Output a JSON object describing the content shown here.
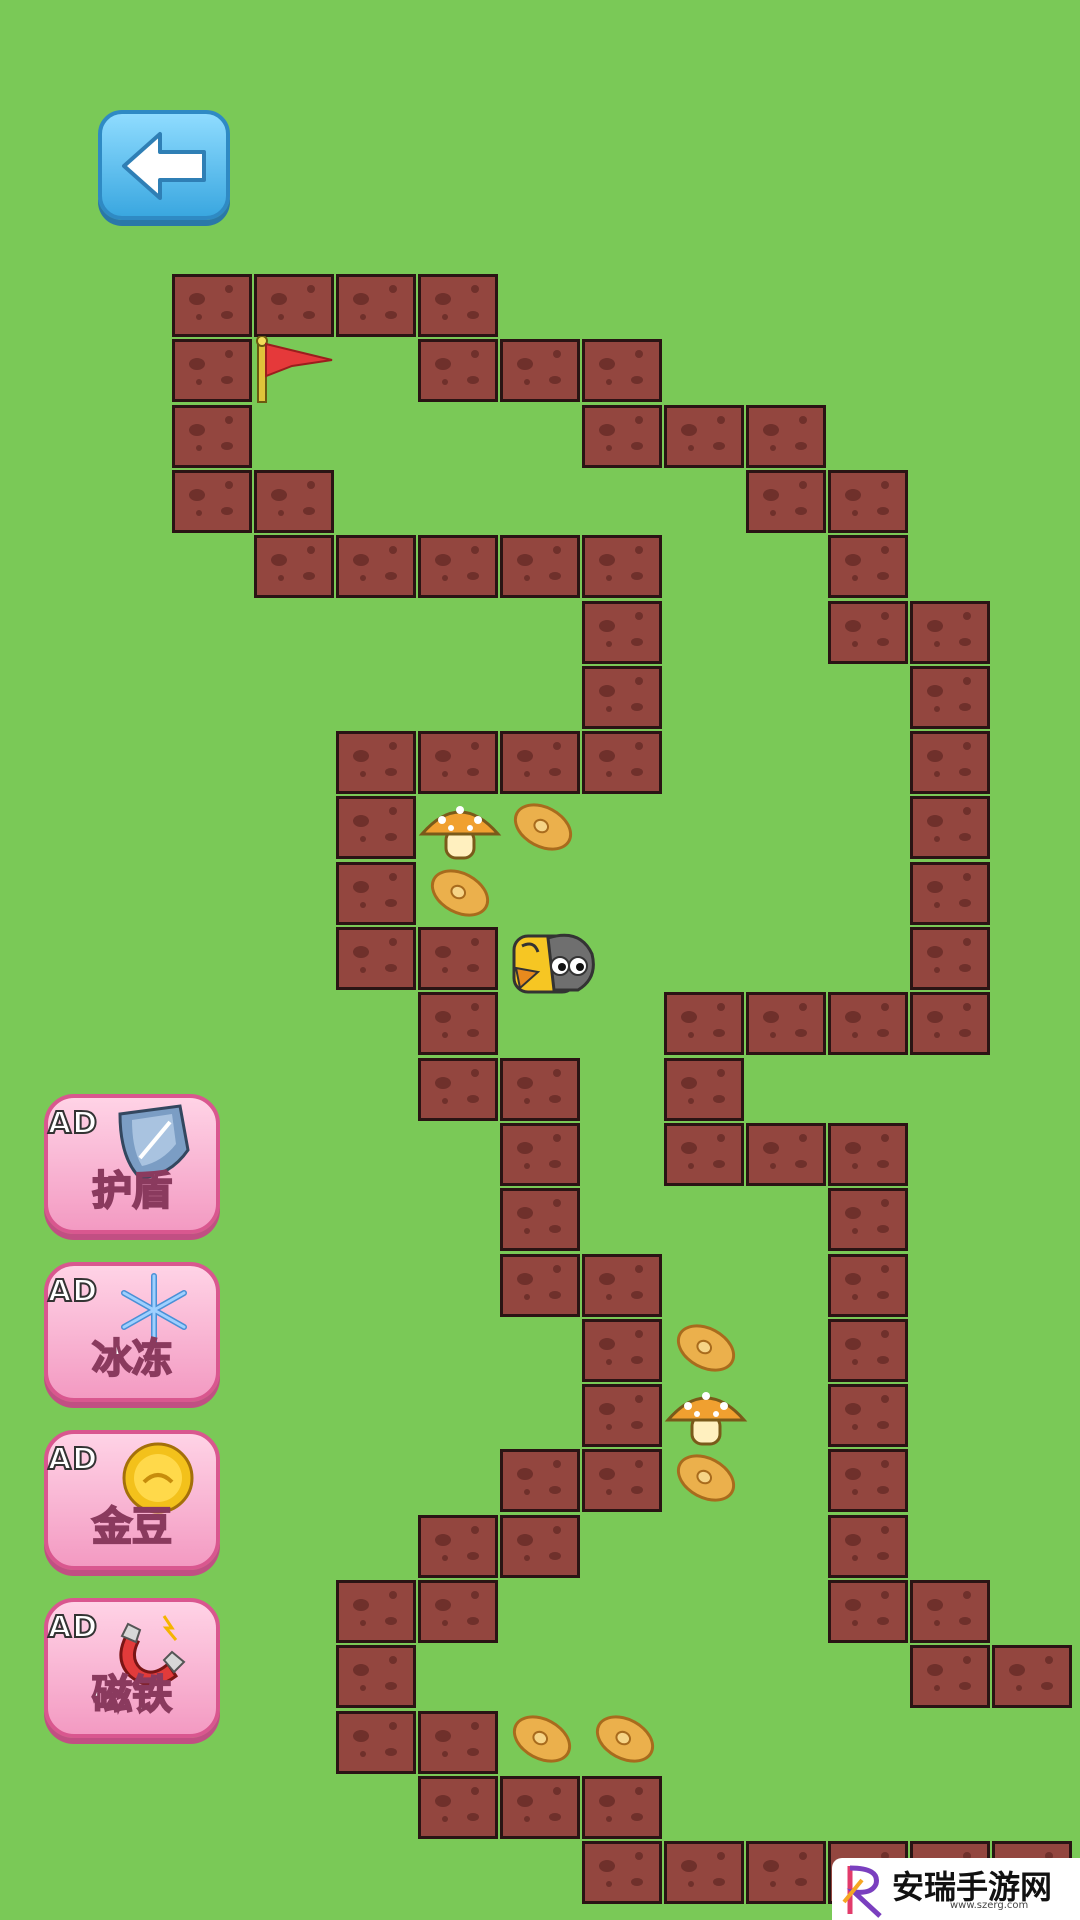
{
  "game": {
    "back_button_icon": "left-arrow-icon",
    "goal_icon": "red-flag-icon",
    "player_icon": "yellow-bird-icon",
    "colors": {
      "background": "#7ac957",
      "wall": "#93463f",
      "bean": "#ebb04c",
      "powerup": "#f39ac2"
    }
  },
  "powerups": [
    {
      "ad_label": "AD",
      "label": "护盾",
      "icon": "shield-icon"
    },
    {
      "ad_label": "AD",
      "label": "冰冻",
      "icon": "snowflake-icon"
    },
    {
      "ad_label": "AD",
      "label": "金豆",
      "icon": "gold-coin-icon"
    },
    {
      "ad_label": "AD",
      "label": "磁铁",
      "icon": "magnet-icon"
    }
  ],
  "watermark": {
    "text": "安瑞手游网",
    "url": "www.szerg.com",
    "icon": "r-logo-icon"
  }
}
